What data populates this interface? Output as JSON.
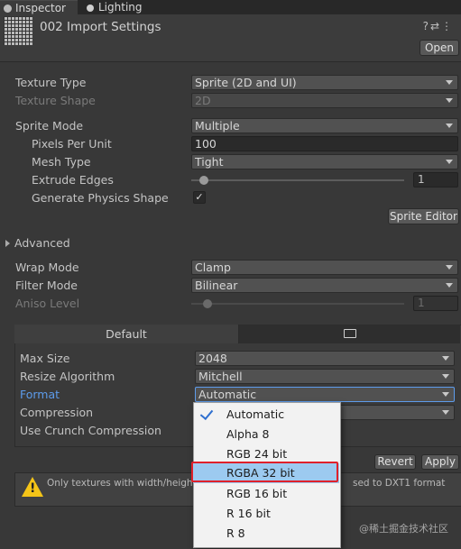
{
  "tabs": [
    {
      "label": "Inspector"
    },
    {
      "label": "Lighting"
    }
  ],
  "header": {
    "title": "002 Import Settings",
    "open_label": "Open"
  },
  "props": {
    "texture_type": {
      "label": "Texture Type",
      "value": "Sprite (2D and UI)"
    },
    "texture_shape": {
      "label": "Texture Shape",
      "value": "2D"
    },
    "sprite_mode": {
      "label": "Sprite Mode",
      "value": "Multiple"
    },
    "pixels_per_unit": {
      "label": "Pixels Per Unit",
      "value": "100"
    },
    "mesh_type": {
      "label": "Mesh Type",
      "value": "Tight"
    },
    "extrude_edges": {
      "label": "Extrude Edges",
      "value": "1"
    },
    "generate_physics": {
      "label": "Generate Physics Shape",
      "checked": true,
      "mark": "✓"
    },
    "sprite_editor_label": "Sprite Editor",
    "advanced_label": "Advanced",
    "wrap_mode": {
      "label": "Wrap Mode",
      "value": "Clamp"
    },
    "filter_mode": {
      "label": "Filter Mode",
      "value": "Bilinear"
    },
    "aniso_level": {
      "label": "Aniso Level",
      "value": "1"
    }
  },
  "platform": {
    "default_tab": "Default",
    "max_size": {
      "label": "Max Size",
      "value": "2048"
    },
    "resize_algorithm": {
      "label": "Resize Algorithm",
      "value": "Mitchell"
    },
    "format": {
      "label": "Format",
      "value": "Automatic"
    },
    "compression": {
      "label": "Compression"
    },
    "use_crunch": {
      "label": "Use Crunch Compression"
    }
  },
  "actions": {
    "revert_label": "Revert",
    "apply_label": "Apply"
  },
  "warning": {
    "text_left": "Only textures with width/height b",
    "text_right": "sed to DXT1 format"
  },
  "format_dropdown": {
    "selected": "Automatic",
    "highlighted": "RGBA 32 bit",
    "options": [
      "Automatic",
      "Alpha 8",
      "RGB 24 bit",
      "RGBA 32 bit",
      "RGB 16 bit",
      "R 16 bit",
      "R 8"
    ]
  },
  "watermark": "@稀土掘金技术社区",
  "colors": {
    "background": "#383838",
    "accent_blue": "#5d9cec",
    "highlight_red": "#e0212b",
    "dropdown_selected": "#9ccaf0",
    "warning_yellow": "#f5c518"
  }
}
